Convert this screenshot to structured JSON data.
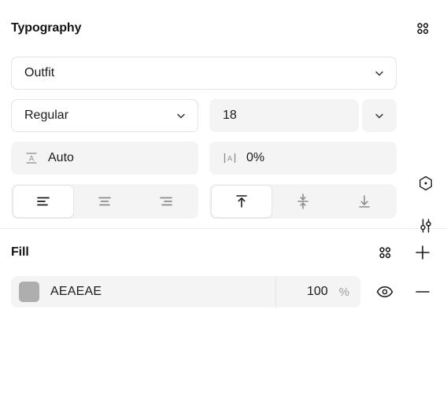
{
  "typography": {
    "title": "Typography",
    "options_icon": "grid-dots-icon",
    "font_family": {
      "value": "Outfit",
      "caret_icon": "chevron-down-icon"
    },
    "font_weight": {
      "value": "Regular",
      "caret_icon": "chevron-down-icon"
    },
    "font_size": {
      "value": "18",
      "caret_icon": "chevron-down-icon"
    },
    "line_height": {
      "icon": "line-height-icon",
      "value": "Auto"
    },
    "letter_spacing": {
      "icon": "letter-spacing-icon",
      "value": "0%"
    },
    "text_align": {
      "options": [
        {
          "label": "align-left",
          "icon": "align-left-icon",
          "active": true
        },
        {
          "label": "align-center",
          "icon": "align-center-icon",
          "active": false
        },
        {
          "label": "align-right",
          "icon": "align-right-icon",
          "active": false
        }
      ]
    },
    "vertical_align": {
      "options": [
        {
          "label": "align-top",
          "icon": "align-top-icon",
          "active": true
        },
        {
          "label": "align-middle",
          "icon": "align-middle-icon",
          "active": false
        },
        {
          "label": "align-bottom",
          "icon": "align-bottom-icon",
          "active": false
        }
      ]
    },
    "type_settings_icon": "hexagon-dot-icon",
    "variable_settings_icon": "sliders-icon"
  },
  "fill": {
    "title": "Fill",
    "options_icon": "grid-dots-icon",
    "add_icon": "plus-icon",
    "layers": [
      {
        "color": "#AEAEAE",
        "hex": "AEAEAE",
        "opacity": "100",
        "opacity_unit": "%",
        "visibility_icon": "eye-icon",
        "remove_icon": "minus-icon"
      }
    ]
  },
  "colors": {
    "background": "#FFFFFF",
    "field_fill": "#F4F4F4",
    "border": "#E3E3E3",
    "divider": "#EAEAEA",
    "text": "#1A1A1A",
    "muted": "#9A9A9A",
    "swatch": "#AEAEAE"
  }
}
